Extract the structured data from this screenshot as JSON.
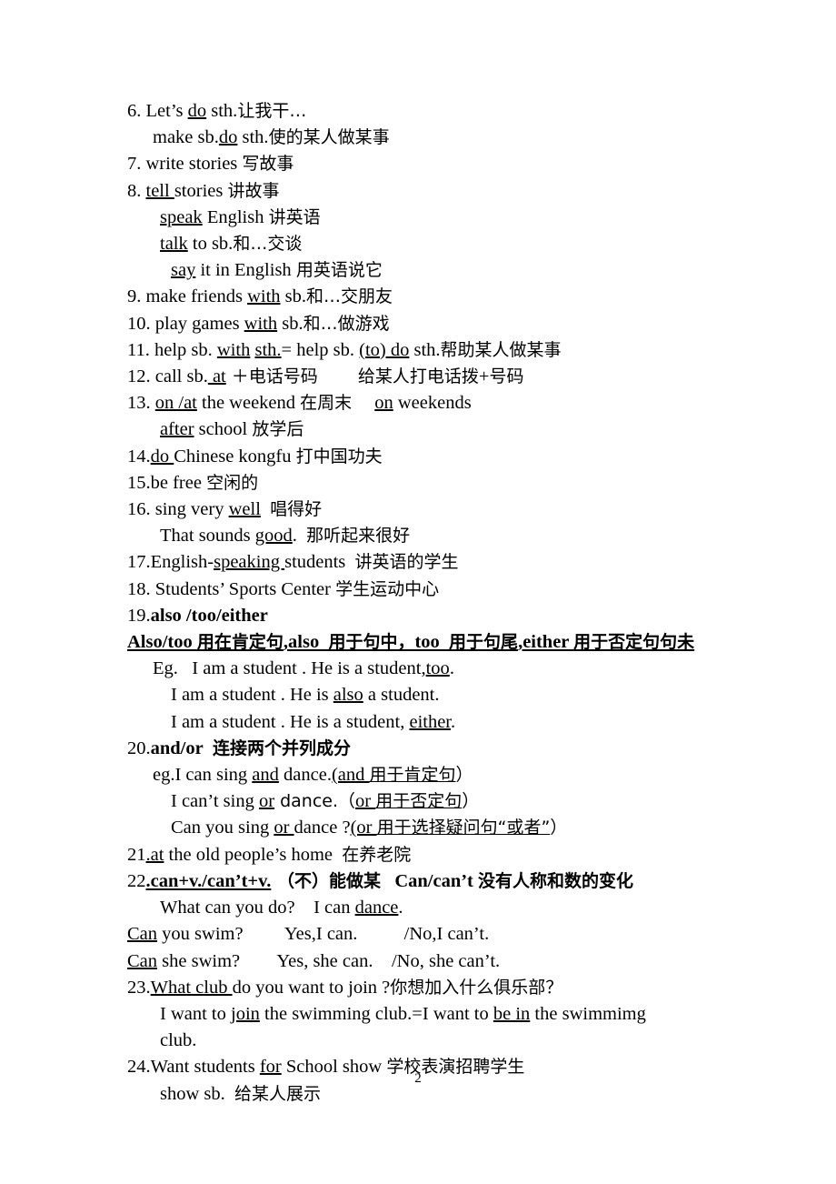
{
  "document": {
    "page_number": "2",
    "entries": [
      {
        "id": "item-6",
        "indent": 0,
        "segments": [
          {
            "text": "6. Let’s ",
            "style": "plain"
          },
          {
            "text": "do",
            "style": "underline"
          },
          {
            "text": " sth.",
            "style": "plain"
          },
          {
            "text": "让我干…",
            "style": "plain"
          }
        ]
      },
      {
        "id": "item-6-sub-1",
        "indent": 1,
        "segments": [
          {
            "text": "make sb.",
            "style": "plain"
          },
          {
            "text": "do",
            "style": "underline"
          },
          {
            "text": " sth.",
            "style": "plain"
          },
          {
            "text": "使的某人做某事",
            "style": "plain"
          }
        ]
      },
      {
        "id": "item-7",
        "indent": 0,
        "segments": [
          {
            "text": "7. write stories ",
            "style": "plain"
          },
          {
            "text": "写故事",
            "style": "plain"
          }
        ]
      },
      {
        "id": "item-8",
        "indent": 0,
        "segments": [
          {
            "text": "8. ",
            "style": "plain"
          },
          {
            "text": "tell ",
            "style": "underline"
          },
          {
            "text": "stories ",
            "style": "plain"
          },
          {
            "text": "讲故事",
            "style": "plain"
          }
        ]
      },
      {
        "id": "item-8-sub-1",
        "indent": 2,
        "segments": [
          {
            "text": "speak",
            "style": "underline"
          },
          {
            "text": " English ",
            "style": "plain"
          },
          {
            "text": "讲英语",
            "style": "plain"
          }
        ]
      },
      {
        "id": "item-8-sub-2",
        "indent": 2,
        "segments": [
          {
            "text": "talk",
            "style": "underline"
          },
          {
            "text": " to sb.",
            "style": "plain"
          },
          {
            "text": "和…交谈",
            "style": "plain"
          }
        ]
      },
      {
        "id": "item-8-sub-3",
        "indent": 3,
        "segments": [
          {
            "text": "say",
            "style": "underline"
          },
          {
            "text": " it in English ",
            "style": "plain"
          },
          {
            "text": "用英语说它",
            "style": "plain"
          }
        ]
      },
      {
        "id": "item-9",
        "indent": 0,
        "segments": [
          {
            "text": "9. make friends ",
            "style": "plain"
          },
          {
            "text": "with",
            "style": "underline"
          },
          {
            "text": " sb.",
            "style": "plain"
          },
          {
            "text": "和…交朋友",
            "style": "plain"
          }
        ]
      },
      {
        "id": "item-10",
        "indent": 0,
        "segments": [
          {
            "text": "10. play games ",
            "style": "plain"
          },
          {
            "text": "with",
            "style": "underline"
          },
          {
            "text": " sb.",
            "style": "plain"
          },
          {
            "text": "和…做游戏",
            "style": "plain"
          }
        ]
      },
      {
        "id": "item-11",
        "indent": 0,
        "segments": [
          {
            "text": "11. help sb. ",
            "style": "plain"
          },
          {
            "text": "with",
            "style": "underline"
          },
          {
            "text": " ",
            "style": "plain"
          },
          {
            "text": "sth.",
            "style": "underline"
          },
          {
            "text": "= help sb. ",
            "style": "plain"
          },
          {
            "text": "(to) do",
            "style": "underline"
          },
          {
            "text": " sth.",
            "style": "plain"
          },
          {
            "text": "帮助某人做某事",
            "style": "plain"
          }
        ]
      },
      {
        "id": "item-12",
        "indent": 0,
        "segments": [
          {
            "text": "12. call sb.",
            "style": "plain"
          },
          {
            "text": " at",
            "style": "underline"
          },
          {
            "text": " ＋",
            "style": "plain"
          },
          {
            "text": "电话号码",
            "style": "plain"
          },
          {
            "text": "　　 ",
            "style": "plain"
          },
          {
            "text": "给某人打电话拨",
            "style": "plain"
          },
          {
            "text": "+",
            "style": "plain"
          },
          {
            "text": "号码",
            "style": "plain"
          }
        ]
      },
      {
        "id": "item-13",
        "indent": 0,
        "segments": [
          {
            "text": "13. ",
            "style": "plain"
          },
          {
            "text": "on /at",
            "style": "underline"
          },
          {
            "text": " the weekend ",
            "style": "plain"
          },
          {
            "text": "在周末",
            "style": "plain"
          },
          {
            "text": "　 ",
            "style": "plain"
          },
          {
            "text": "on",
            "style": "underline"
          },
          {
            "text": " weekends",
            "style": "plain"
          }
        ]
      },
      {
        "id": "item-13-sub-1",
        "indent": 2,
        "segments": [
          {
            "text": "after",
            "style": "underline"
          },
          {
            "text": " school ",
            "style": "plain"
          },
          {
            "text": "放学后",
            "style": "plain"
          }
        ]
      },
      {
        "id": "item-14",
        "indent": 0,
        "segments": [
          {
            "text": "14.",
            "style": "plain"
          },
          {
            "text": "do ",
            "style": "underline"
          },
          {
            "text": "Chinese kongfu ",
            "style": "plain"
          },
          {
            "text": "打中国功夫",
            "style": "plain"
          }
        ]
      },
      {
        "id": "item-15",
        "indent": 0,
        "segments": [
          {
            "text": "15.be free ",
            "style": "plain"
          },
          {
            "text": "空闲的",
            "style": "plain"
          }
        ]
      },
      {
        "id": "item-16",
        "indent": 0,
        "segments": [
          {
            "text": "16. sing very ",
            "style": "plain"
          },
          {
            "text": "well",
            "style": "underline"
          },
          {
            "text": "  ",
            "style": "plain"
          },
          {
            "text": "唱得好",
            "style": "plain"
          }
        ]
      },
      {
        "id": "item-16-sub-1",
        "indent": 2,
        "segments": [
          {
            "text": "That sounds ",
            "style": "plain"
          },
          {
            "text": "good",
            "style": "underline"
          },
          {
            "text": ".  ",
            "style": "plain"
          },
          {
            "text": "那听起来很好",
            "style": "plain"
          }
        ]
      },
      {
        "id": "item-17",
        "indent": 0,
        "segments": [
          {
            "text": "17.English-",
            "style": "plain"
          },
          {
            "text": "speaking ",
            "style": "underline"
          },
          {
            "text": "students  ",
            "style": "plain"
          },
          {
            "text": "讲英语的学生",
            "style": "plain"
          }
        ]
      },
      {
        "id": "item-18",
        "indent": 0,
        "segments": [
          {
            "text": "18. Students’ Sports Center ",
            "style": "plain"
          },
          {
            "text": "学生运动中心",
            "style": "plain"
          }
        ]
      },
      {
        "id": "item-19",
        "indent": 0,
        "segments": [
          {
            "text": "19.",
            "style": "plain"
          },
          {
            "text": "also /too/either",
            "style": "bold"
          }
        ]
      },
      {
        "id": "item-19-rule",
        "indent": 0,
        "line_style": "bold-underline",
        "segments": [
          {
            "text": "Also/too ",
            "style": "plain"
          },
          {
            "text": "用在肯定句",
            "style": "plain"
          },
          {
            "text": ",also  ",
            "style": "plain"
          },
          {
            "text": "用于句中，",
            "style": "plain"
          },
          {
            "text": "too  ",
            "style": "plain"
          },
          {
            "text": "用于句尾",
            "style": "plain"
          },
          {
            "text": ",either ",
            "style": "plain"
          },
          {
            "text": "用于否定句句未",
            "style": "plain"
          }
        ]
      },
      {
        "id": "item-19-eg-1",
        "indent": 1,
        "segments": [
          {
            "text": "Eg.   I am a student . He is a student,",
            "style": "plain"
          },
          {
            "text": "too",
            "style": "underline"
          },
          {
            "text": ".",
            "style": "plain"
          }
        ]
      },
      {
        "id": "item-19-eg-2",
        "indent": 3,
        "segments": [
          {
            "text": "I am a student . He is ",
            "style": "plain"
          },
          {
            "text": "also",
            "style": "underline"
          },
          {
            "text": " a student.",
            "style": "plain"
          }
        ]
      },
      {
        "id": "item-19-eg-3",
        "indent": 3,
        "segments": [
          {
            "text": "I am a student . He is a student, ",
            "style": "plain"
          },
          {
            "text": "either",
            "style": "underline"
          },
          {
            "text": ".",
            "style": "plain"
          }
        ]
      },
      {
        "id": "item-20",
        "indent": 0,
        "segments": [
          {
            "text": "20.",
            "style": "plain"
          },
          {
            "text": "and/or",
            "style": "bold"
          },
          {
            "text": "  ",
            "style": "plain"
          },
          {
            "text": "连接两个并列成分",
            "style": "bold"
          }
        ]
      },
      {
        "id": "item-20-eg-1",
        "indent": 1,
        "segments": [
          {
            "text": "eg.I can sing ",
            "style": "plain"
          },
          {
            "text": "and",
            "style": "underline"
          },
          {
            "text": " dance.",
            "style": "plain"
          },
          {
            "text": "(and ",
            "style": "underline"
          },
          {
            "text": "用于肯定句",
            "style": "underline"
          },
          {
            "text": "）",
            "style": "plain"
          }
        ]
      },
      {
        "id": "item-20-eg-2",
        "indent": 3,
        "segments": [
          {
            "text": "I can’t sing ",
            "style": "plain"
          },
          {
            "text": "or",
            "style": "underline"
          },
          {
            "text": " dance.（",
            "style": "plain"
          },
          {
            "text": "or ",
            "style": "underline"
          },
          {
            "text": "用于否定句",
            "style": "underline"
          },
          {
            "text": "）",
            "style": "plain"
          }
        ]
      },
      {
        "id": "item-20-eg-3",
        "indent": 3,
        "segments": [
          {
            "text": "Can you sing ",
            "style": "plain"
          },
          {
            "text": "or ",
            "style": "underline"
          },
          {
            "text": "dance ?",
            "style": "plain"
          },
          {
            "text": "(or ",
            "style": "underline"
          },
          {
            "text": "用于选择疑问句“或者”",
            "style": "underline"
          },
          {
            "text": "）",
            "style": "plain"
          }
        ]
      },
      {
        "id": "item-21",
        "indent": 0,
        "segments": [
          {
            "text": "21",
            "style": "plain"
          },
          {
            "text": ".at",
            "style": "underline"
          },
          {
            "text": " the old people’s home  ",
            "style": "plain"
          },
          {
            "text": "在养老院",
            "style": "plain"
          }
        ]
      },
      {
        "id": "item-22",
        "indent": 0,
        "segments": [
          {
            "text": "22",
            "style": "plain"
          },
          {
            "text": ".can+v./can’t+v.",
            "style": "bold-underline"
          },
          {
            "text": " （不）能做某",
            "style": "bold"
          },
          {
            "text": "   ",
            "style": "plain"
          },
          {
            "text": "Can/can’t ",
            "style": "bold"
          },
          {
            "text": "没有人称和数的变化",
            "style": "bold"
          }
        ]
      },
      {
        "id": "item-22-sub-1",
        "indent": 2,
        "segments": [
          {
            "text": "What can you do?    I can ",
            "style": "plain"
          },
          {
            "text": "dance",
            "style": "underline"
          },
          {
            "text": ".",
            "style": "plain"
          }
        ]
      },
      {
        "id": "item-22-sub-2",
        "indent": 0,
        "segments": [
          {
            "text": "Can",
            "style": "underline"
          },
          {
            "text": " you swim?         Yes,I can.          /No,I can’t.",
            "style": "plain"
          }
        ]
      },
      {
        "id": "item-22-sub-3",
        "indent": 0,
        "segments": [
          {
            "text": "Can",
            "style": "underline"
          },
          {
            "text": " she swim?        Yes, she can.    /No, she can’t.",
            "style": "plain"
          }
        ]
      },
      {
        "id": "item-23",
        "indent": 0,
        "segments": [
          {
            "text": "23.",
            "style": "plain"
          },
          {
            "text": "What club ",
            "style": "underline"
          },
          {
            "text": "do you want to join ?",
            "style": "plain"
          },
          {
            "text": "你想加入什么俱乐部？",
            "style": "plain"
          }
        ]
      },
      {
        "id": "item-23-sub-1",
        "indent": 2,
        "segments": [
          {
            "text": "I want to ",
            "style": "plain"
          },
          {
            "text": "join",
            "style": "underline"
          },
          {
            "text": " the swimming club.=I want to ",
            "style": "plain"
          },
          {
            "text": "be in",
            "style": "underline"
          },
          {
            "text": " the swimmimg",
            "style": "plain"
          }
        ]
      },
      {
        "id": "item-23-sub-2",
        "indent": 2,
        "segments": [
          {
            "text": "club.",
            "style": "plain"
          }
        ]
      },
      {
        "id": "item-24",
        "indent": 0,
        "segments": [
          {
            "text": "24.Want students ",
            "style": "plain"
          },
          {
            "text": "for",
            "style": "underline"
          },
          {
            "text": " School show ",
            "style": "plain"
          },
          {
            "text": "学校表演招聘学生",
            "style": "plain"
          }
        ]
      },
      {
        "id": "item-24-sub-1",
        "indent": 2,
        "segments": [
          {
            "text": "show sb.  ",
            "style": "plain"
          },
          {
            "text": "给某人展示",
            "style": "plain"
          }
        ]
      }
    ]
  }
}
